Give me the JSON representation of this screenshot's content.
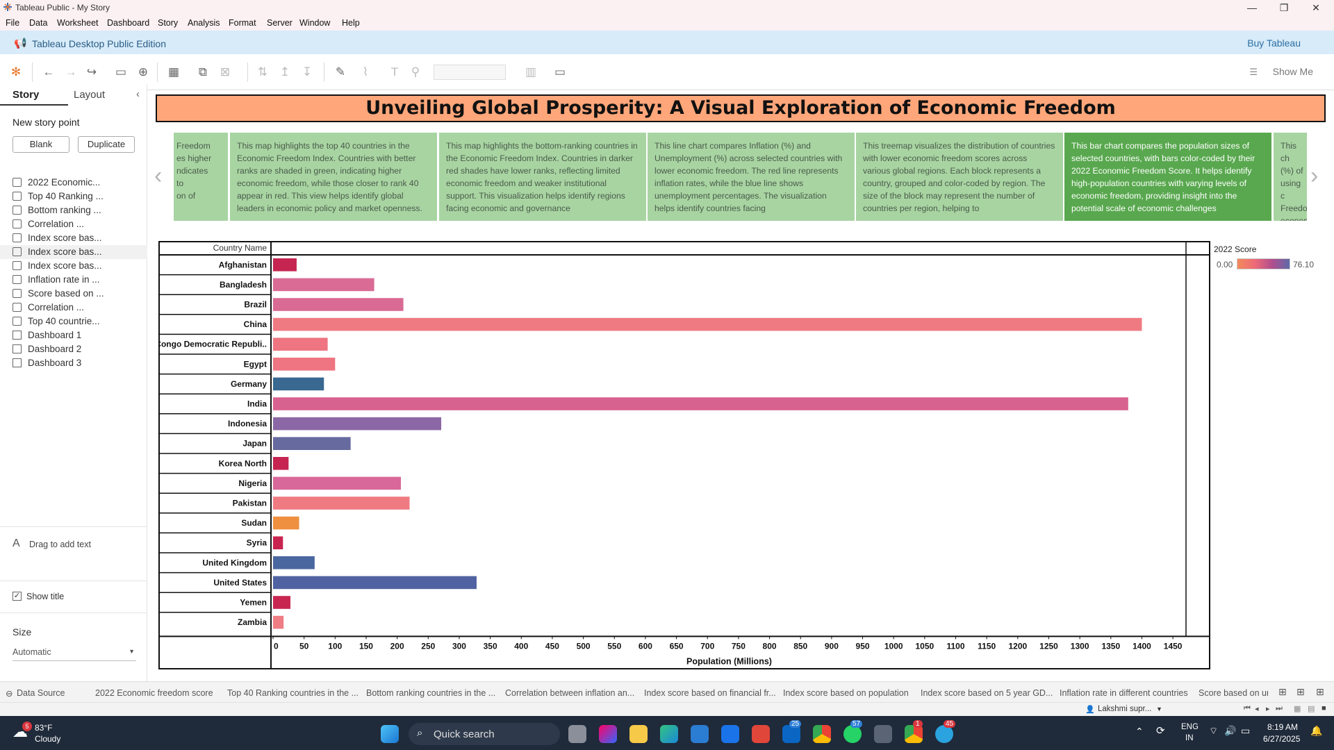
{
  "window": {
    "title": "Tableau Public - My Story"
  },
  "menu": [
    "File",
    "Data",
    "Worksheet",
    "Dashboard",
    "Story",
    "Analysis",
    "Format",
    "Server",
    "Window",
    "Help"
  ],
  "edition": {
    "label": "Tableau Desktop Public Edition",
    "buy": "Buy Tableau"
  },
  "toolbar": {
    "show_me": "Show Me"
  },
  "left_panel": {
    "tabs": [
      "Story",
      "Layout"
    ],
    "new_point_label": "New story point",
    "blank_button": "Blank",
    "duplicate_button": "Duplicate",
    "sheets": [
      "2022 Economic...",
      "Top 40 Ranking ...",
      "Bottom ranking ...",
      "Correlation ...",
      "Index score bas...",
      "Index score bas...",
      "Index score bas...",
      "Inflation rate in ...",
      "Score based on ...",
      "Correlation ...",
      "Top 40 countrie...",
      "Dashboard 1",
      "Dashboard 2",
      "Dashboard 3"
    ],
    "drag_text": "Drag to add text",
    "show_title": "Show title",
    "size_label": "Size",
    "size_value": "Automatic"
  },
  "story": {
    "title": "Unveiling Global Prosperity: A Visual Exploration of Economic Freedom",
    "captions": [
      "Freedom\nes higher\nndicates\nto\non of",
      "This map highlights the top 40 countries in the Economic Freedom Index. Countries with better ranks are shaded in green, indicating higher economic freedom, while those closer to rank 40 appear in red. This view helps identify global leaders in economic policy and market openness.",
      "This map highlights the bottom-ranking countries in the Economic Freedom Index. Countries in darker red shades have lower ranks, reflecting limited economic freedom and weaker institutional support. This visualization helps identify regions facing economic and governance",
      "This line chart compares Inflation (%) and Unemployment (%) across selected countries with lower economic freedom. The red line represents inflation rates, while the blue line shows unemployment percentages. The visualization helps identify countries facing",
      "This treemap visualizes the distribution of countries with lower economic freedom scores across various global regions. Each block represents a country, grouped and color-coded by region. The size of the block may represent the number of countries per region, helping to",
      "This bar chart compares the population sizes of selected countries, with bars color-coded by their 2022 Economic Freedom Score. It helps identify high-population countries with varying levels of economic freedom, providing insight into the potential scale of economic challenges",
      "This ch\n(%) of\nusing c\nFreedo\neconom\nrelate"
    ]
  },
  "chart_data": {
    "type": "bar",
    "orientation": "horizontal",
    "row_header": "Country Name",
    "xlabel": "Population (Millions)",
    "xlim": [
      0,
      1470
    ],
    "xticks": [
      0,
      50,
      100,
      150,
      200,
      250,
      300,
      350,
      400,
      450,
      500,
      550,
      600,
      650,
      700,
      750,
      800,
      850,
      900,
      950,
      1000,
      1050,
      1100,
      1150,
      1200,
      1250,
      1300,
      1350,
      1400,
      1450
    ],
    "categories": [
      "Afghanistan",
      "Bangladesh",
      "Brazil",
      "China",
      "Congo Democratic Republi..",
      "Egypt",
      "Germany",
      "India",
      "Indonesia",
      "Japan",
      "Korea North",
      "Nigeria",
      "Pakistan",
      "Sudan",
      "Syria",
      "United Kingdom",
      "United States",
      "Yemen",
      "Zambia"
    ],
    "values": [
      38,
      163,
      210,
      1400,
      88,
      100,
      82,
      1378,
      271,
      125,
      25,
      206,
      220,
      42,
      16,
      67,
      328,
      28,
      17
    ],
    "colors": [
      "#c52550",
      "#d96b95",
      "#d86a93",
      "#ef7a82",
      "#ee7581",
      "#ee7581",
      "#396890",
      "#d8628f",
      "#8b68a5",
      "#676a9f",
      "#c52550",
      "#d9689a",
      "#ef7a82",
      "#ef9040",
      "#c9244f",
      "#4b679f",
      "#5062a1",
      "#c82650",
      "#ee7d84"
    ],
    "legend": {
      "title": "2022 Score",
      "min": "0.00",
      "max": "76.10",
      "colors": [
        "#f18a5b",
        "#ee6b78",
        "#b14e8d",
        "#5f6aa9"
      ]
    }
  },
  "bottom_tabs": [
    "Data Source",
    "2022 Economic freedom score",
    "Top 40 Ranking countries in the ...",
    "Bottom ranking countries in the ...",
    "Correlation between inflation an...",
    "Index score based on financial fr...",
    "Index score based on population",
    "Index score based on 5 year GD...",
    "Inflation rate in different countries",
    "Score based on ur"
  ],
  "status": {
    "user": "Lakshmi supr..."
  },
  "taskbar": {
    "weather_temp": "83°F",
    "weather_cond": "Cloudy",
    "weather_badge": "5",
    "search": "Quick search",
    "lang1": "ENG",
    "lang2": "IN",
    "time": "8:19 AM",
    "date": "6/27/2025",
    "badges": [
      "25",
      "57",
      "1",
      "45"
    ]
  }
}
